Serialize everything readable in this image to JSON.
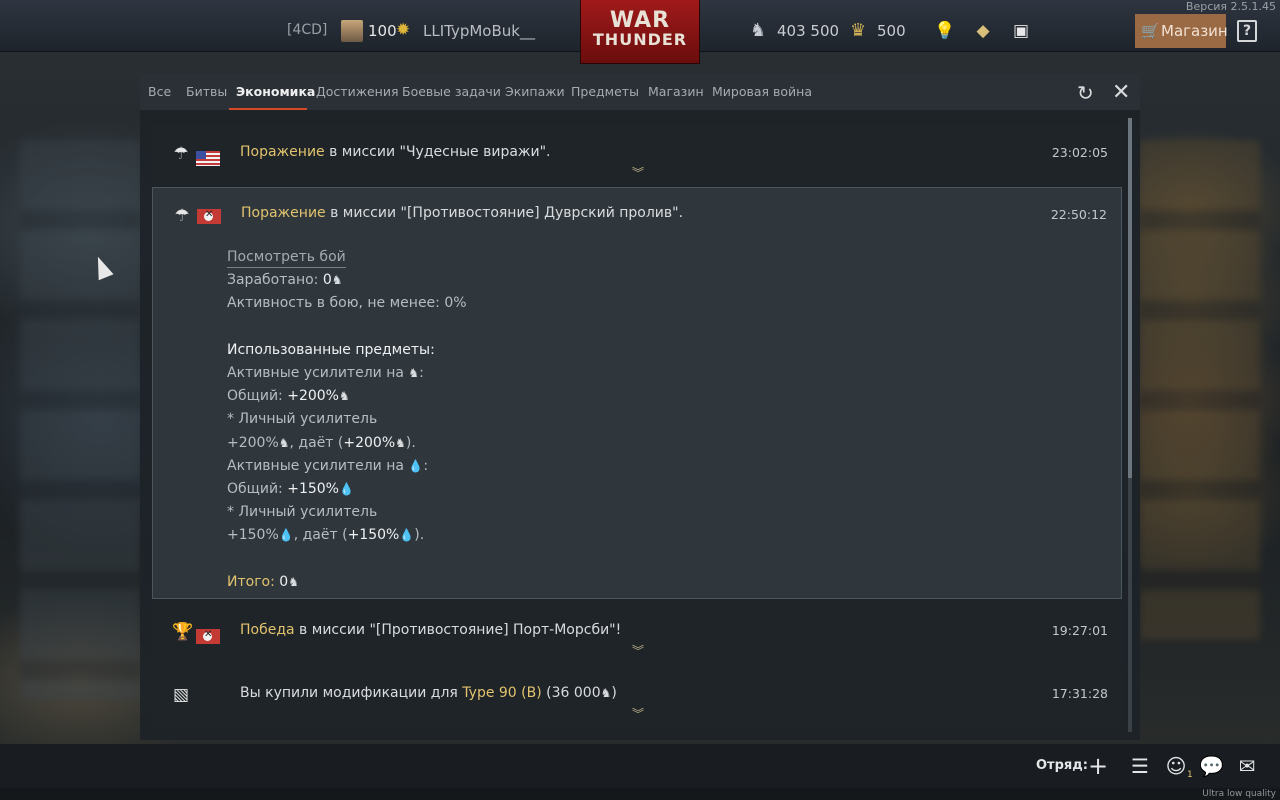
{
  "version": "Версия 2.5.1.45",
  "profile": {
    "clan_tag": "[4CD]",
    "rank": "100",
    "username": "LLITypMoBuk__"
  },
  "logo": {
    "line1": "WAR",
    "line2": "THUNDER"
  },
  "currency": {
    "silver": "403 500",
    "gold": "500"
  },
  "topbar": {
    "shop_label": "Магазин",
    "help_label": "?"
  },
  "tabs": [
    {
      "label": "Все"
    },
    {
      "label": "Битвы"
    },
    {
      "label": "Экономика"
    },
    {
      "label": "Достижения"
    },
    {
      "label": "Боевые задачи"
    },
    {
      "label": "Экипажи"
    },
    {
      "label": "Предметы"
    },
    {
      "label": "Магазин"
    },
    {
      "label": "Мировая война"
    }
  ],
  "active_tab": "Экономика",
  "rows": [
    {
      "status": "Поражение",
      "text": " в миссии \"Чудесные виражи\".",
      "time": "23:02:05",
      "flag": "usa"
    },
    {
      "status": "Поражение",
      "text": " в миссии \"[Противостояние] Дуврский пролив\".",
      "time": "22:50:12",
      "flag": "germany",
      "details": {
        "view_battle": "Посмотреть бой",
        "earned_label": "Заработано: ",
        "earned_value": "0",
        "activity": "Активность в бою, не менее: 0%",
        "used_items": "Использованные предметы:",
        "boosters_sl": "Активные усилители на ",
        "total_label": "Общий: ",
        "total_sl": "+200%",
        "personal": "* Личный усилитель",
        "personal_sl": "+200%",
        "gives": ", даёт (",
        "gives_sl": "+200%",
        "close": ").",
        "boosters_rp": "Активные усилители на ",
        "total_rp": "+150%",
        "personal_rp": "+150%",
        "gives_rp": "+150%",
        "result_label": "Итого: ",
        "result_value": "0"
      }
    },
    {
      "status": "Победа",
      "text": " в миссии \"[Противостояние] Порт-Морсби\"!",
      "time": "19:27:01",
      "flag": "germany"
    },
    {
      "prefix": "Вы купили модификации для ",
      "vehicle": "Type 90 (B)",
      "amount": " (36 000",
      "suffix": ")",
      "time": "17:31:28"
    }
  ],
  "bottombar": {
    "squad_label": "Отряд:",
    "friends_count": "1"
  },
  "quality": "Ultra low quality",
  "icons": {
    "silver": "lion-icon",
    "gold": "eagles-icon",
    "rp": "research-point-icon",
    "lose": "parachute-icon",
    "win": "trophy-icon",
    "purchase": "box-icon"
  },
  "colors": {
    "accent": "#d54a26",
    "highlight": "#e1c36d",
    "shop": "#9a6a45",
    "logo": "#a01a1a"
  }
}
